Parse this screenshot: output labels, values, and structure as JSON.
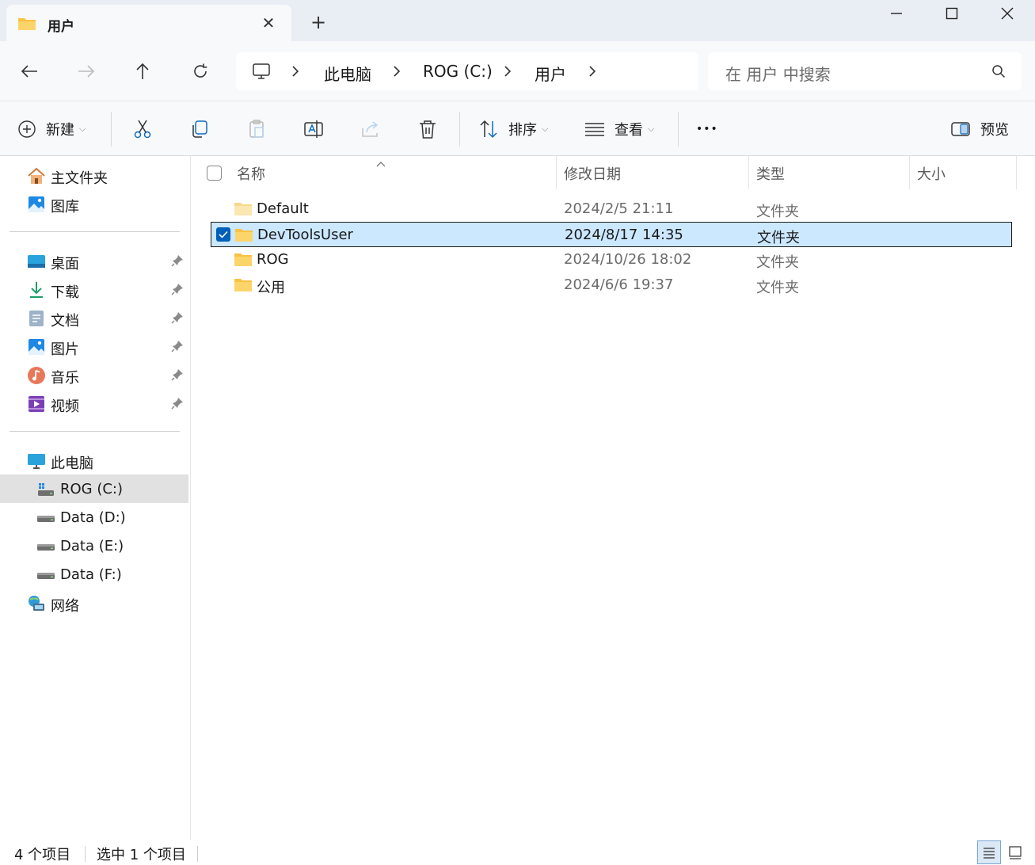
{
  "tab": {
    "title": "用户",
    "close_glyph": "✕",
    "new_tab_glyph": "+"
  },
  "window": {
    "minimize_icon": "minimize-icon",
    "maximize_icon": "maximize-icon",
    "close_icon": "close-icon"
  },
  "address": {
    "computer_icon": "computer-icon",
    "crumbs": [
      "此电脑",
      "ROG (C:)",
      "用户"
    ]
  },
  "search": {
    "placeholder": "在 用户 中搜索"
  },
  "toolbar": {
    "new_label": "新建",
    "sort_label": "排序",
    "view_label": "查看",
    "more_glyph": "•••",
    "preview_label": "预览"
  },
  "sidebar": {
    "quick": [
      {
        "label": "主文件夹",
        "icon": "home-icon"
      },
      {
        "label": "图库",
        "icon": "gallery-icon"
      }
    ],
    "pinned": [
      {
        "label": "桌面",
        "icon": "desktop-icon"
      },
      {
        "label": "下载",
        "icon": "download-icon"
      },
      {
        "label": "文档",
        "icon": "document-icon"
      },
      {
        "label": "图片",
        "icon": "pictures-icon"
      },
      {
        "label": "音乐",
        "icon": "music-icon"
      },
      {
        "label": "视频",
        "icon": "video-icon"
      }
    ],
    "this_pc": "此电脑",
    "drives": [
      {
        "label": "ROG (C:)",
        "selected": true
      },
      {
        "label": "Data (D:)",
        "selected": false
      },
      {
        "label": "Data (E:)",
        "selected": false
      },
      {
        "label": "Data (F:)",
        "selected": false
      }
    ],
    "network": "网络"
  },
  "columns": {
    "name": "名称",
    "modified": "修改日期",
    "type": "类型",
    "size": "大小"
  },
  "files": [
    {
      "name": "Default",
      "modified": "2024/2/5 21:11",
      "type": "文件夹",
      "selected": false
    },
    {
      "name": "DevToolsUser",
      "modified": "2024/8/17 14:35",
      "type": "文件夹",
      "selected": true
    },
    {
      "name": "ROG",
      "modified": "2024/10/26 18:02",
      "type": "文件夹",
      "selected": false
    },
    {
      "name": "公用",
      "modified": "2024/6/6 19:37",
      "type": "文件夹",
      "selected": false
    }
  ],
  "status": {
    "item_count": "4 个项目",
    "selection": "选中 1 个项目"
  },
  "colors": {
    "accent": "#005fb8",
    "selection_bg": "#cce8ff",
    "folder": "#f8c244"
  }
}
